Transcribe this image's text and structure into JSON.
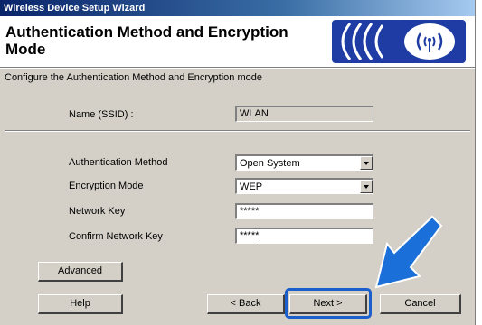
{
  "window": {
    "title": "Wireless Device Setup Wizard"
  },
  "banner": {
    "title": "Authentication Method and Encryption Mode",
    "logo_icon": "wireless-signal-icon"
  },
  "description": "Configure the Authentication Method and Encryption mode",
  "form": {
    "ssid_label": "Name (SSID) :",
    "ssid_value": "WLAN",
    "auth_label": "Authentication Method",
    "auth_value": "Open System",
    "encryption_label": "Encryption Mode",
    "encryption_value": "WEP",
    "key_label": "Network Key",
    "key_value": "*****",
    "confirm_label": "Confirm Network Key",
    "confirm_value": "*****"
  },
  "buttons": {
    "advanced": "Advanced",
    "help": "Help",
    "back": "< Back",
    "next": "Next >",
    "cancel": "Cancel"
  },
  "colors": {
    "dialog": "#d4d0c8",
    "highlight": "#1a5fcc"
  }
}
